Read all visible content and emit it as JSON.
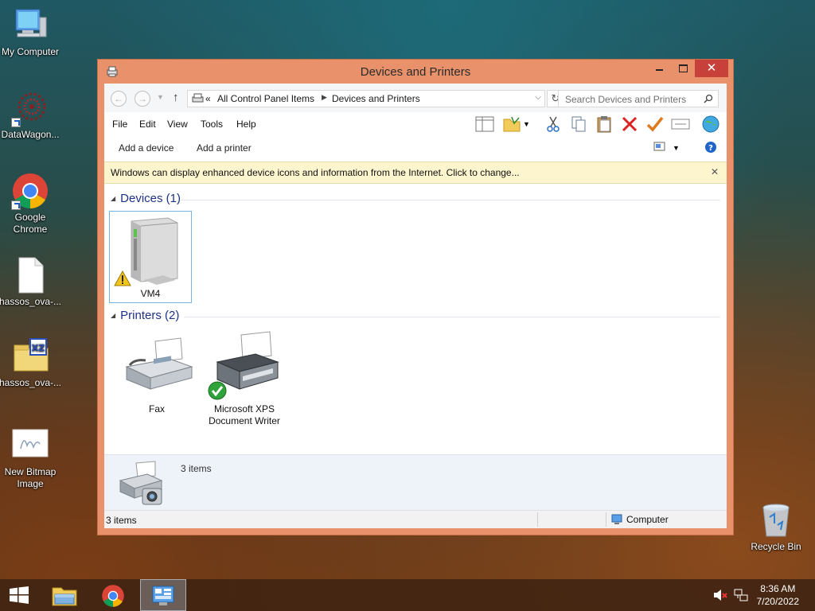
{
  "desktop": {
    "icons": [
      {
        "label": "My Computer",
        "icon": "computer-icon"
      },
      {
        "label": "DataWagon...",
        "icon": "datawagon-icon"
      },
      {
        "label": "Google Chrome",
        "icon": "chrome-icon"
      },
      {
        "label": "hassos_ova-...",
        "icon": "file-icon"
      },
      {
        "label": "hassos_ova-...",
        "icon": "xz-archive-icon"
      },
      {
        "label": "New Bitmap Image",
        "icon": "bitmap-icon"
      },
      {
        "label": "Recycle Bin",
        "icon": "recycle-bin-icon"
      }
    ]
  },
  "window": {
    "title": "Devices and Printers",
    "address": {
      "overflow": "«",
      "crumbs": [
        "All Control Panel Items",
        "Devices and Printers"
      ]
    },
    "search": {
      "placeholder": "Search Devices and Printers"
    },
    "menu": [
      "File",
      "Edit",
      "View",
      "Tools",
      "Help"
    ],
    "commands": {
      "add_device": "Add a device",
      "add_printer": "Add a printer"
    },
    "infobar": {
      "text": "Windows can display enhanced device icons and information from the Internet. Click to change..."
    },
    "groups": {
      "devices": {
        "header": "Devices (1)",
        "items": [
          {
            "label": "VM4",
            "warning": true
          }
        ]
      },
      "printers": {
        "header": "Printers (2)",
        "items": [
          {
            "label": "Fax",
            "default": false
          },
          {
            "label": "Microsoft XPS Document Writer",
            "default": true
          }
        ]
      }
    },
    "details": {
      "count": "3 items"
    },
    "status": {
      "left": "3 items",
      "zone": "Computer"
    }
  },
  "taskbar": {
    "time": "8:36 AM",
    "date": "7/20/2022",
    "items": [
      "start-button",
      "file-explorer",
      "chrome",
      "devices-and-printers"
    ]
  },
  "colors": {
    "window_frame": "#e8916a",
    "close_button": "#c7413a",
    "infobar": "#fdf5ce",
    "group_header": "#1e3287",
    "details_pane": "#eef2f9"
  }
}
